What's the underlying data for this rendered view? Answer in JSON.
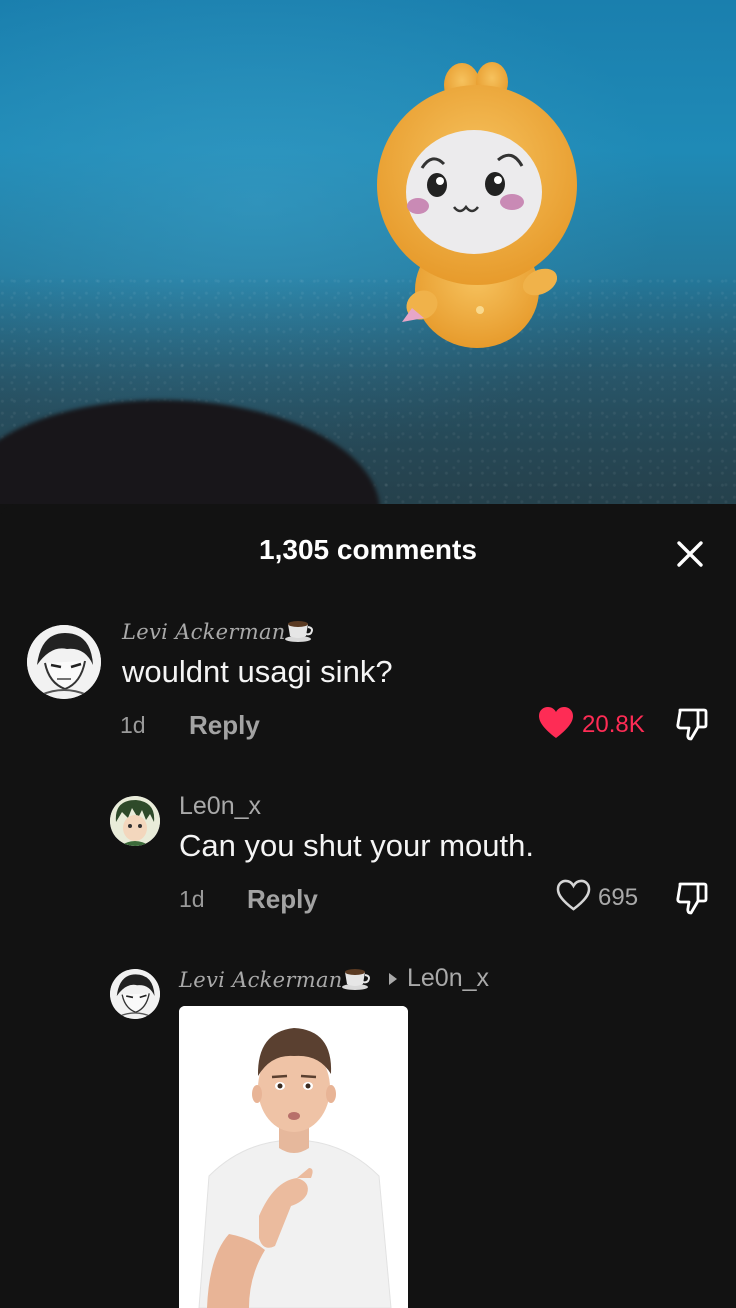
{
  "sheet": {
    "title": "1,305 comments"
  },
  "comments": [
    {
      "username": "Levi Ackerman",
      "text": "wouldnt usagi sink?",
      "time": "1d",
      "reply_label": "Reply",
      "likes": "20.8K",
      "liked": true
    },
    {
      "username": "Le0n_x",
      "text": "Can you shut your mouth.",
      "time": "1d",
      "reply_label": "Reply",
      "likes": "695",
      "liked": false
    },
    {
      "username": "Levi Ackerman",
      "reply_to": "Le0n_x"
    }
  ],
  "colors": {
    "like_active": "#fe2c55",
    "secondary_text": "#a9a9a9",
    "background": "#121212"
  },
  "icons": [
    "close-icon",
    "heart-filled-icon",
    "heart-outline-icon",
    "dislike-icon",
    "coffee-cup-icon",
    "reply-arrow-icon"
  ]
}
